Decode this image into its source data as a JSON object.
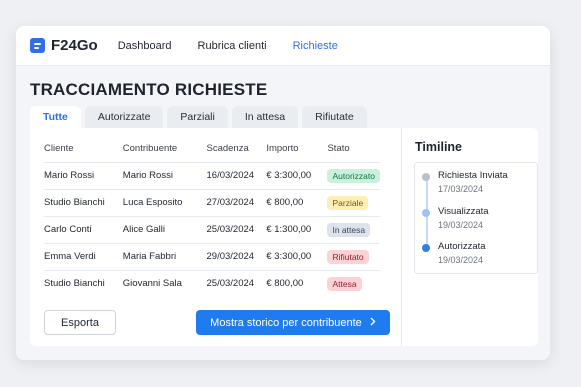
{
  "app": {
    "name": "F24Go"
  },
  "nav": [
    {
      "label": "Dashboard",
      "active": false
    },
    {
      "label": "Rubrica clienti",
      "active": false
    },
    {
      "label": "Richieste",
      "active": true
    }
  ],
  "page": {
    "title": "TRACCIAMENTO RICHIESTE"
  },
  "tabs": [
    {
      "label": "Tutte",
      "active": true
    },
    {
      "label": "Autorizzate",
      "active": false
    },
    {
      "label": "Parziali",
      "active": false
    },
    {
      "label": "In attesa",
      "active": false
    },
    {
      "label": "Rifiutate",
      "active": false
    }
  ],
  "table": {
    "headers": [
      "Cliente",
      "Contribuente",
      "Scadenza",
      "Importo",
      "Stato"
    ],
    "rows": [
      {
        "cliente": "Mario Rossi",
        "contribuente": "Mario Rossi",
        "scadenza": "16/03/2024",
        "importo": "€ 3:300,00",
        "stato": "Autorizzato",
        "stato_color": "#c9f1dc",
        "stato_text": "#157347"
      },
      {
        "cliente": "Studio Bianchi",
        "contribuente": "Luca Esposito",
        "scadenza": "27/03/2024",
        "importo": "€ 800,00",
        "stato": "Parziale",
        "stato_color": "#fdeeb5",
        "stato_text": "#7a5a00"
      },
      {
        "cliente": "Carlo Conti",
        "contribuente": "Alice Galli",
        "scadenza": "25/03/2024",
        "importo": "€ 1:300,00",
        "stato": "In attesa",
        "stato_color": "#dde3ec",
        "stato_text": "#3c4454"
      },
      {
        "cliente": "Emma Verdi",
        "contribuente": "Maria Fabbri",
        "scadenza": "29/03/2024",
        "importo": "€ 3:300,00",
        "stato": "Rifiutato",
        "stato_color": "#fbd3d6",
        "stato_text": "#8e1f2a"
      },
      {
        "cliente": "Studio Bianchi",
        "contribuente": "Giovanni Sala",
        "scadenza": "25/03/2024",
        "importo": "€ 800,00",
        "stato": "Attesa",
        "stato_color": "#fbd3d6",
        "stato_text": "#8e1f2a"
      }
    ]
  },
  "actions": {
    "export_label": "Esporta",
    "history_label": "Mostra storico per contribuente",
    "history_icon": "chevron-right-icon"
  },
  "timeline": {
    "title": "Timiline",
    "items": [
      {
        "label": "Richiesta Inviata",
        "date": "17/03/2024",
        "dot_color": "#b9c0cc"
      },
      {
        "label": "Visualizzata",
        "date": "19/03/2024",
        "dot_color": "#9fc3f5"
      },
      {
        "label": "Autorizzata",
        "date": "19/03/2024",
        "dot_color": "#2f7fe8"
      }
    ]
  },
  "colors": {
    "accent": "#2f6fe6",
    "primary_button": "#1f7cf0"
  }
}
